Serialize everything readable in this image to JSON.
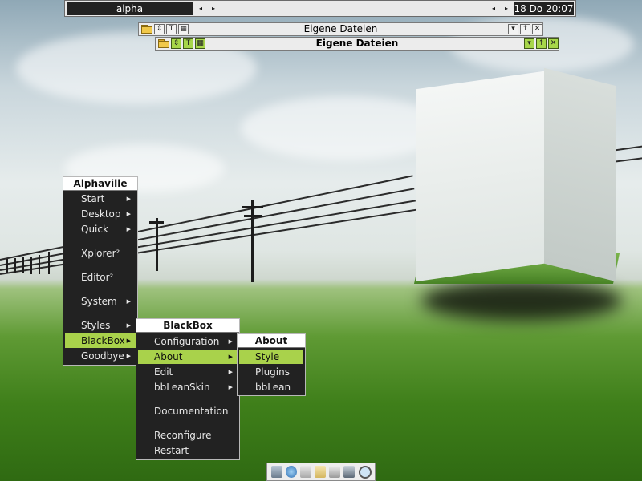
{
  "toolbar": {
    "workspace": "alpha",
    "prev_arrow": "◂",
    "next_arrow": "▸",
    "clock": "18 Do 20:07"
  },
  "windows": [
    {
      "title": "Eigene Dateien",
      "active": false
    },
    {
      "title": "Eigene Dateien",
      "active": true
    }
  ],
  "menu_main": {
    "title": "Alphaville",
    "items": [
      "Start",
      "Desktop",
      "Quick",
      "Xplorer²",
      "Editor²",
      "System",
      "Styles",
      "BlackBox",
      "Goodbye"
    ]
  },
  "menu_blackbox": {
    "title": "BlackBox",
    "items": [
      "Configuration",
      "About",
      "Edit",
      "bbLeanSkin",
      "Documentation",
      "Reconfigure",
      "Restart"
    ]
  },
  "menu_about": {
    "title": "About",
    "items": [
      "Style",
      "Plugins",
      "bbLean"
    ]
  },
  "colors": {
    "menu_bg": "#222222",
    "highlight": "#a9d24b",
    "title_bg": "#ffffff"
  },
  "tray_icons": [
    "recycle-bin-icon",
    "browser-icon",
    "network-icon",
    "folder-icon",
    "printer-icon",
    "tools-icon",
    "search-icon"
  ]
}
